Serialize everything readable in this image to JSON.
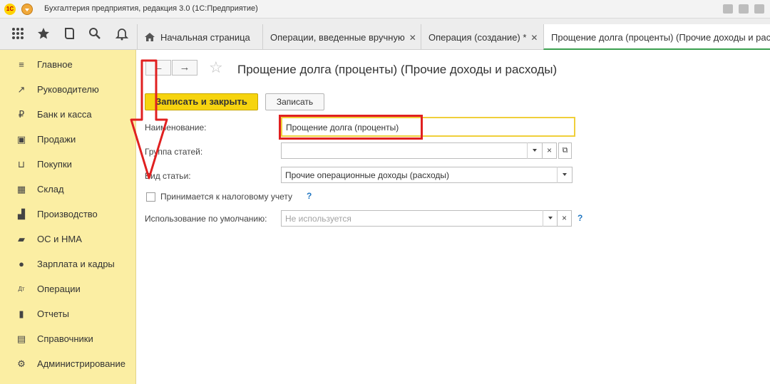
{
  "app": {
    "title": "Бухгалтерия предприятия, редакция 3.0  (1С:Предприятие)",
    "logo_text": "1С"
  },
  "tabs": [
    {
      "label": "Начальная страница",
      "icon": "home-icon",
      "closable": false
    },
    {
      "label": "Операции, введенные вручную",
      "closable": true
    },
    {
      "label": "Операция (создание) *",
      "closable": true
    },
    {
      "label": "Прощение долга (проценты) (Прочие доходы и расходы)",
      "closable": false
    }
  ],
  "tab_close_glyph": "✕",
  "sidebar": {
    "items": [
      {
        "label": "Главное",
        "icon": "menu-lines-icon"
      },
      {
        "label": "Руководителю",
        "icon": "trend-icon"
      },
      {
        "label": "Банк и касса",
        "icon": "ruble-icon"
      },
      {
        "label": "Продажи",
        "icon": "bag-icon"
      },
      {
        "label": "Покупки",
        "icon": "cart-icon"
      },
      {
        "label": "Склад",
        "icon": "warehouse-icon"
      },
      {
        "label": "Производство",
        "icon": "factory-icon"
      },
      {
        "label": "ОС и НМА",
        "icon": "truck-icon"
      },
      {
        "label": "Зарплата и кадры",
        "icon": "person-icon"
      },
      {
        "label": "Операции",
        "icon": "dt-kt-icon"
      },
      {
        "label": "Отчеты",
        "icon": "bar-chart-icon"
      },
      {
        "label": "Справочники",
        "icon": "book-icon"
      },
      {
        "label": "Администрирование",
        "icon": "gear-icon"
      }
    ],
    "icon_glyphs": [
      "≡",
      "↗",
      "₽",
      "▣",
      "⊔",
      "▦",
      "▟",
      "▰",
      "●",
      "Дт",
      "▮",
      "▤",
      "⚙"
    ]
  },
  "form": {
    "title": "Прощение долга (проценты) (Прочие доходы и расходы)",
    "nav_back": "←",
    "nav_forward": "→",
    "star_glyph": "☆",
    "save_close_label": "Записать и закрыть",
    "save_label": "Записать",
    "name_label": "Наименование:",
    "name_value": "Прощение долга (проценты)",
    "group_label": "Группа статей:",
    "group_value": "",
    "kind_label": "Вид статьи:",
    "kind_value": "Прочие операционные доходы (расходы)",
    "tax_label": "Принимается к налоговому учету",
    "tax_checked": false,
    "usage_label": "Использование по умолчанию:",
    "usage_placeholder": "Не используется",
    "help_glyph": "?",
    "clear_glyph": "×",
    "open_glyph": "⧉"
  },
  "colors": {
    "sidebar_bg": "#fbeea3",
    "primary_button": "#f6d40f",
    "active_tab_underline": "#3aa04f",
    "annotation_red": "#e02020",
    "help_blue": "#1f76c2"
  }
}
